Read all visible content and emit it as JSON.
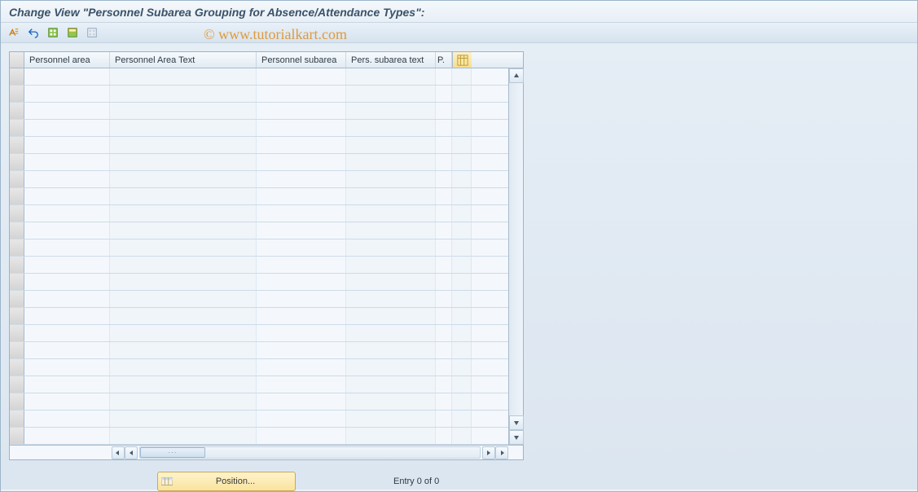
{
  "title": "Change View \"Personnel Subarea Grouping for Absence/Attendance Types\":",
  "watermark": "© www.tutorialkart.com",
  "columns": {
    "c1": "Personnel area",
    "c2": "Personnel Area Text",
    "c3": "Personnel subarea",
    "c4": "Pers. subarea text",
    "c5": "P."
  },
  "row_count": 22,
  "position_button": "Position...",
  "entry_text": "Entry 0 of 0",
  "toolbar": [
    "change-display-toggle",
    "undo",
    "select-all",
    "save-select",
    "deselect-all"
  ]
}
